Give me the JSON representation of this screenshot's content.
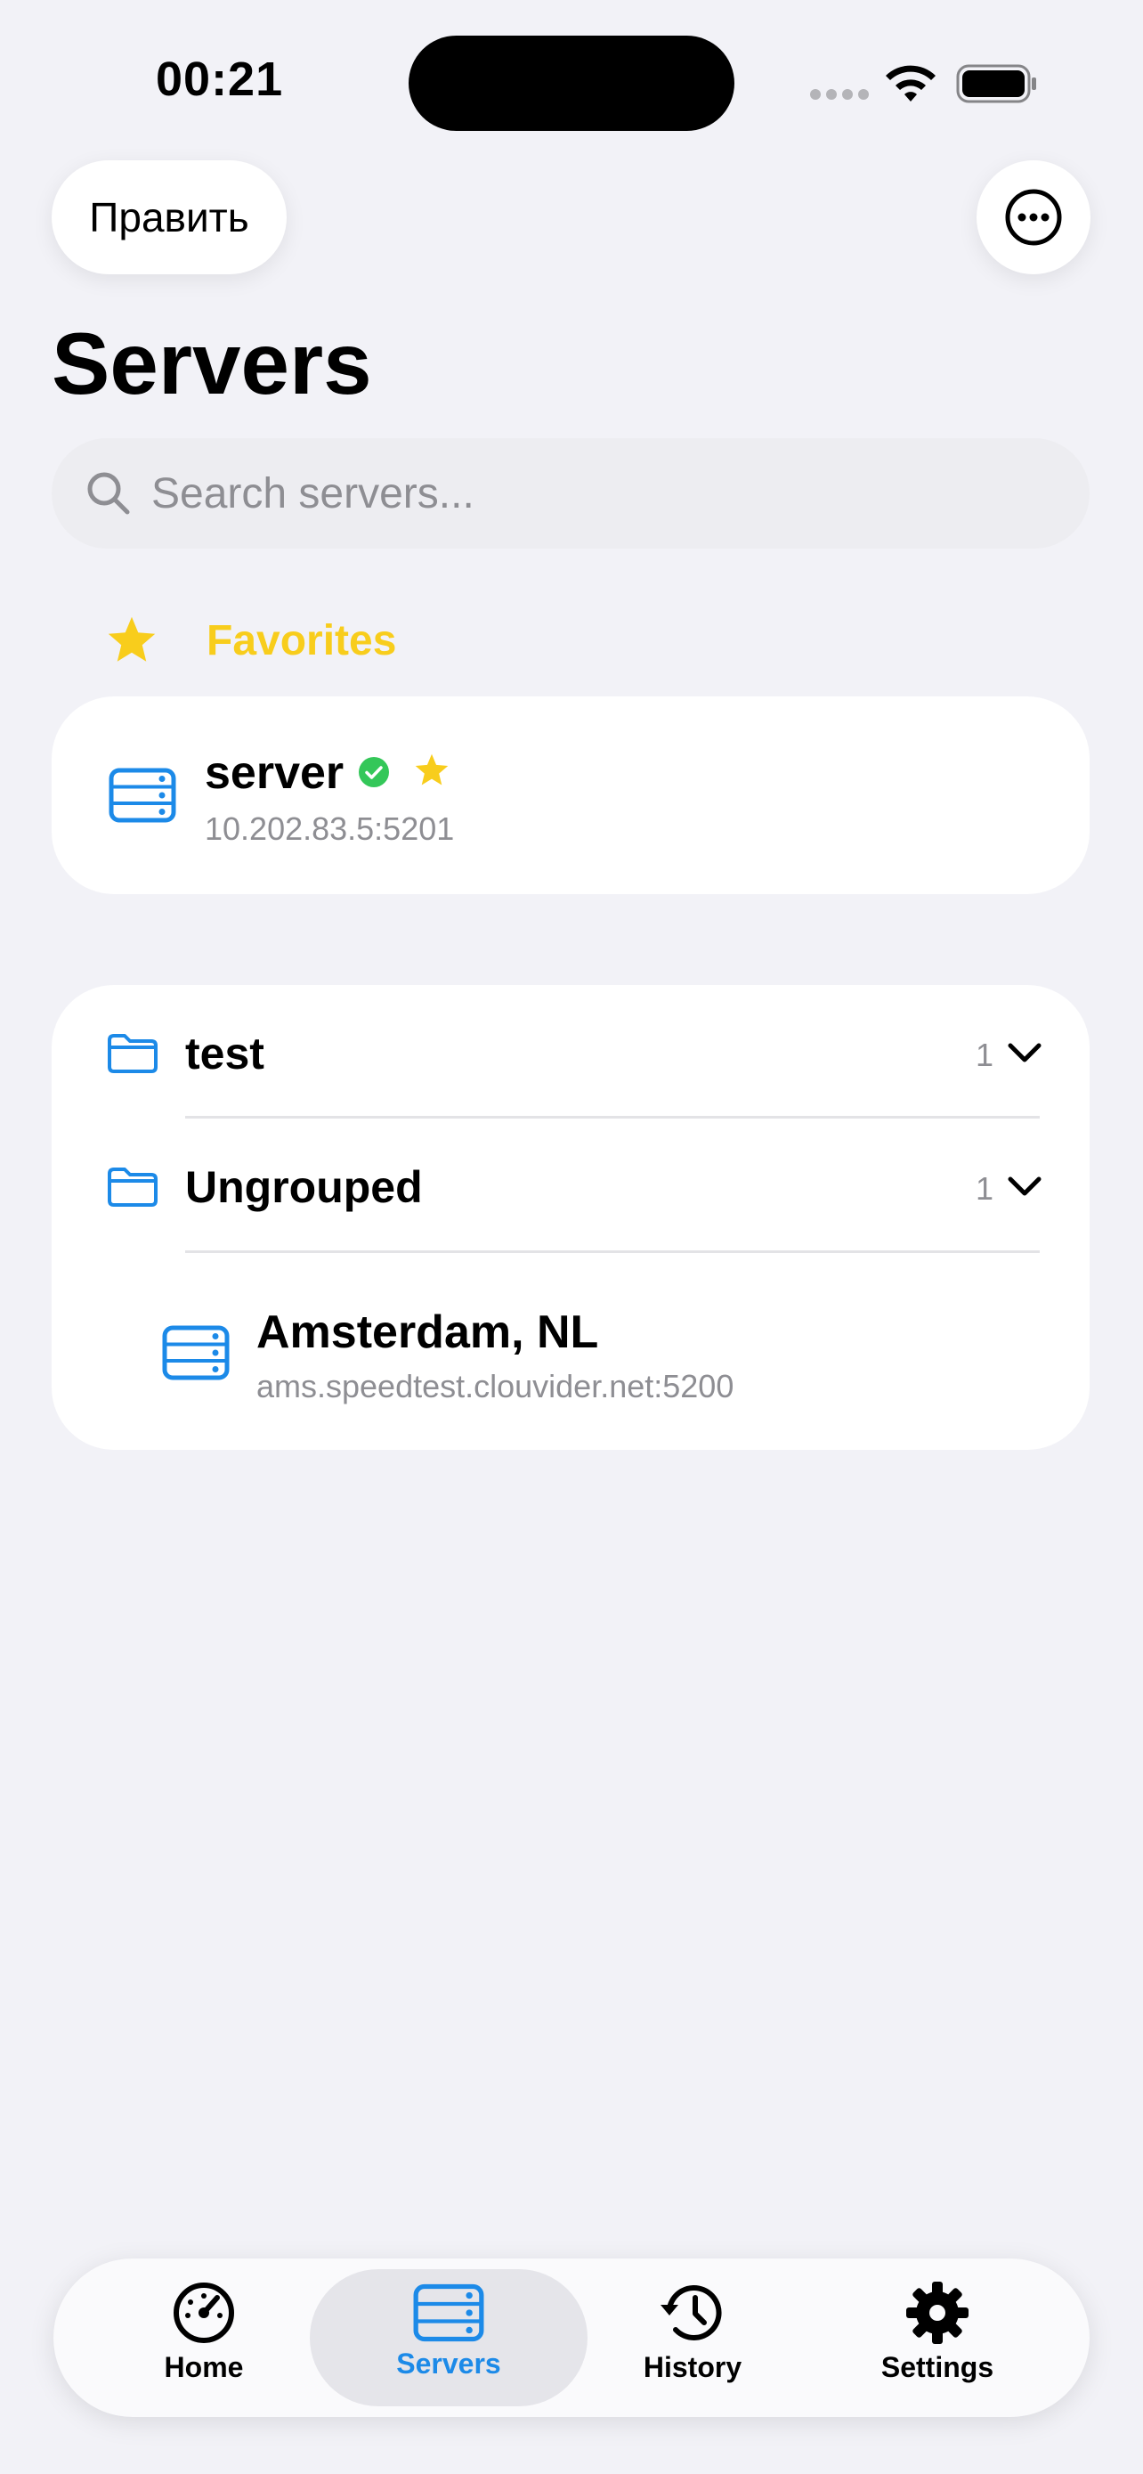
{
  "status_bar": {
    "time": "00:21"
  },
  "nav": {
    "edit_label": "Править"
  },
  "page": {
    "title": "Servers"
  },
  "search": {
    "placeholder": "Search servers..."
  },
  "favorites": {
    "header": "Favorites",
    "items": [
      {
        "name": "server",
        "address": "10.202.83.5:5201",
        "online": true,
        "favorite": true
      }
    ]
  },
  "groups": [
    {
      "name": "test",
      "count": "1",
      "expanded": false
    },
    {
      "name": "Ungrouped",
      "count": "1",
      "expanded": true,
      "servers": [
        {
          "name": "Amsterdam, NL",
          "address": "ams.speedtest.clouvider.net:5200"
        }
      ]
    }
  ],
  "tabs": [
    {
      "label": "Home",
      "icon": "speedometer-icon",
      "active": false
    },
    {
      "label": "Servers",
      "icon": "server-rack-icon",
      "active": true
    },
    {
      "label": "History",
      "icon": "history-clock-icon",
      "active": false
    },
    {
      "label": "Settings",
      "icon": "gear-icon",
      "active": false
    }
  ],
  "colors": {
    "accent": "#1C8AE8",
    "favorite": "#F8CD1C",
    "online": "#34C759",
    "background": "#F2F2F7"
  }
}
